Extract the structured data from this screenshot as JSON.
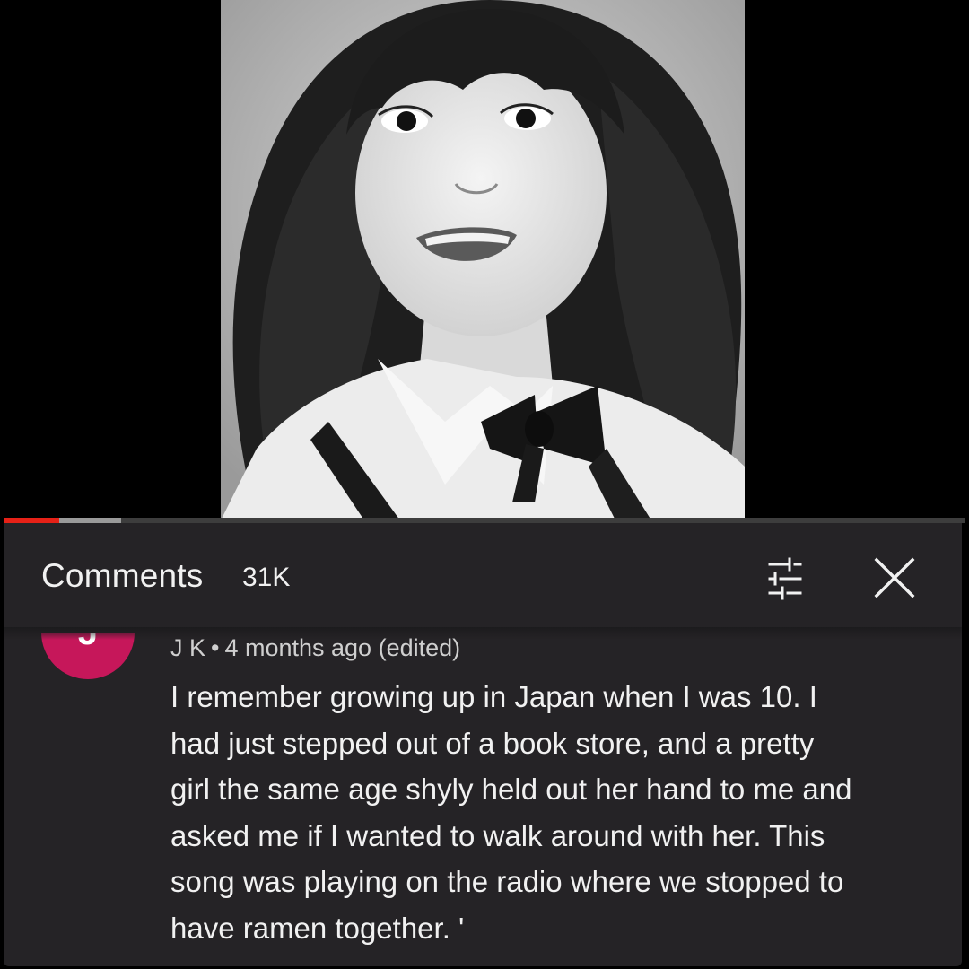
{
  "video": {
    "progress_played": 0.058,
    "progress_buffered": 0.122
  },
  "comments": {
    "title": "Comments",
    "count": "31K",
    "filter_icon": "sort-filter-icon",
    "close_icon": "close-icon"
  },
  "comment": {
    "avatar_letter": "J",
    "author": "J K",
    "separator": "•",
    "time": "4 months ago",
    "edited": "(edited)",
    "text_lines": [
      "I remember growing up in Japan when I was 10. I",
      "had just stepped out of a book store,  and a pretty",
      "girl the same age shyly held out her hand to me and",
      "asked me if I wanted to walk around with her. This",
      "song was playing on the radio where we stopped to",
      "have ramen together. '"
    ]
  },
  "colors": {
    "panel_bg": "#252326",
    "avatar_bg": "#c6175a",
    "progress_red": "#e62117"
  }
}
